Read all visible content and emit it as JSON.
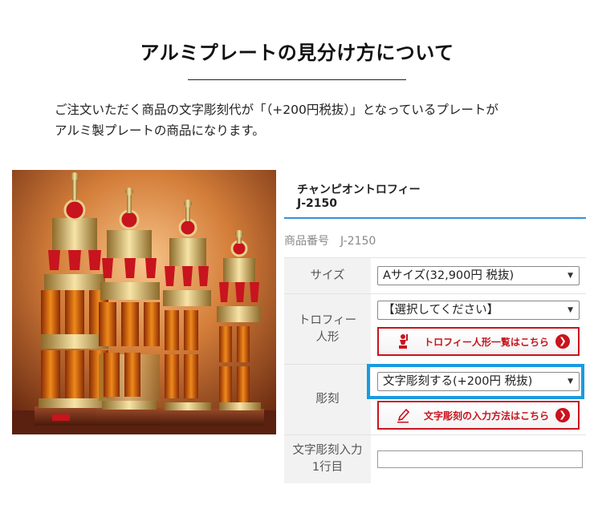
{
  "heading": "アルミプレートの見分け方について",
  "intro_lines": [
    "ご注文いただく商品の文字彫刻代が「（+200円税抜）」となっているプレートが",
    "アルミ製プレートの商品になります。"
  ],
  "product": {
    "name": "チャンピオントロフィー",
    "code": "J-2150",
    "sku_label": "商品番号　J-2150"
  },
  "rows": {
    "size": {
      "label": "サイズ",
      "value": "Aサイズ(32,900円 税抜)"
    },
    "figure": {
      "label_line1": "トロフィー",
      "label_line2": "人形",
      "value": "【選択してください】",
      "button": "トロフィー人形一覧はこちら"
    },
    "engraving": {
      "label": "彫刻",
      "value": "文字彫刻する(+200円 税抜)",
      "button": "文字彫刻の入力方法はこちら"
    },
    "engraving_text": {
      "label_line1": "文字彫刻入力",
      "label_line2": "1行目",
      "value": ""
    }
  },
  "icons": {
    "dropdown": "triangle-down",
    "button_arrow": "chevron-right-circle",
    "figure_button": "trophy-figure",
    "engraving_button": "pencil"
  },
  "colors": {
    "accent_blue": "#3a8fd6",
    "highlight": "#1a9be0",
    "button_red": "#c8141e"
  }
}
